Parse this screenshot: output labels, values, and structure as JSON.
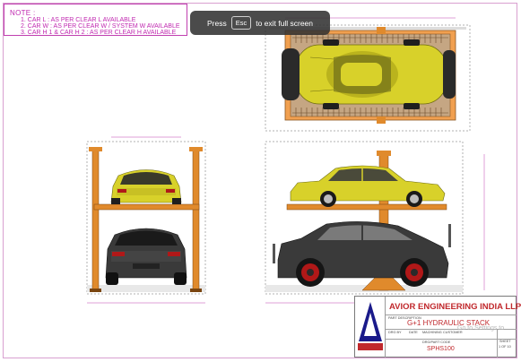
{
  "note": {
    "title": "NOTE :",
    "lines": [
      "1. CAR L : AS PER CLEAR L AVAILABLE",
      "2. CAR W : AS PER CLEAR W / SYSTEM W AVAILABLE",
      "3. CAR H 1 & CAR H 2 : AS PER CLEAR H AVAILABLE"
    ]
  },
  "fullscreen_toast": {
    "press": "Press",
    "key": "Esc",
    "suffix": "to exit full screen"
  },
  "title_block": {
    "company": "AVIOR ENGINEERING INDIA LLP",
    "part_description_label": "PART DESCRIPTION",
    "part_description": "G+1 HYDRAULIC STACK",
    "drg_by_label": "DRG BY",
    "date_label": "DATE",
    "machining_label": "MACHINING",
    "customer_label": "CUSTOMER",
    "drg_part_code_label": "DRG/PART CODE",
    "part_code": "SPHS100",
    "sheet_label": "SHEET",
    "sheet_value": "1 OF 10",
    "logo_text": "AVIOR"
  },
  "watermark": "Go to Settings to",
  "colors": {
    "note_text": "#c028b0",
    "car_yellow": "#d8d12a",
    "car_dark": "#3a3a3a",
    "frame_orange": "#e08a2c",
    "title_red": "#c0282c"
  }
}
